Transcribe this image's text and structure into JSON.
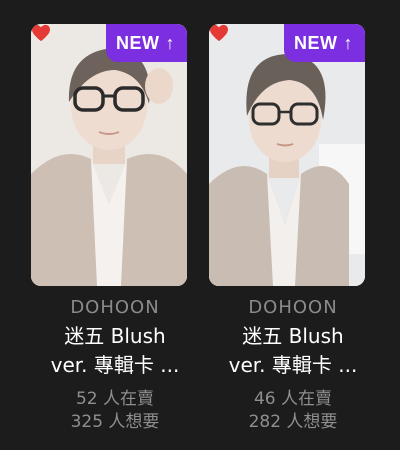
{
  "cards": [
    {
      "badge": "NEW",
      "badge_icon": "↑",
      "brand": "DOHOON",
      "title_line1": "迷五 Blush",
      "title_line2": "ver. 專輯卡 ...",
      "selling": "52 人在賣",
      "wanting": "325 人想要",
      "favorited": true
    },
    {
      "badge": "NEW",
      "badge_icon": "↑",
      "brand": "DOHOON",
      "title_line1": "迷五 Blush",
      "title_line2": "ver. 專輯卡 ...",
      "selling": "46 人在賣",
      "wanting": "282 人想要",
      "favorited": true
    }
  ],
  "colors": {
    "background": "#1c1c1c",
    "badge": "#7b2fe0",
    "heart": "#e53935",
    "brand_text": "#8b8b8b",
    "title_text": "#ffffff",
    "stats_text": "#8f8f8f"
  }
}
